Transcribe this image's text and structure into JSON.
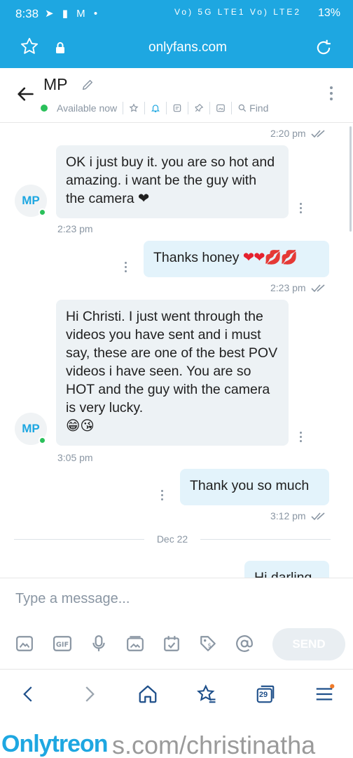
{
  "status_bar": {
    "time": "8:38",
    "battery": "13%",
    "network": "Vo) 5G LTE1 Vo) LTE2"
  },
  "browser": {
    "url": "onlyfans.com"
  },
  "chat_header": {
    "name": "MP",
    "presence": "Available now",
    "find_label": "Find"
  },
  "messages": [
    {
      "direction": "out",
      "text": "",
      "time": "2:20 pm"
    },
    {
      "direction": "in",
      "avatar": "MP",
      "text": "OK i just buy it. you are so hot and amazing. i want be the guy with the camera ❤",
      "time": "2:23 pm"
    },
    {
      "direction": "out",
      "text": "Thanks honey",
      "emoji": "❤❤💋💋",
      "time": "2:23 pm"
    },
    {
      "direction": "in",
      "avatar": "MP",
      "text": "Hi Christi. I just went through the videos you have sent and i must say, these are one of the best POV videos i have seen. You are so HOT and the guy with the camera is very lucky.",
      "emoji": "😁😘",
      "time": "3:05 pm"
    },
    {
      "direction": "out",
      "text": "Thank you so much",
      "time": "3:12 pm"
    },
    {
      "direction": "out",
      "text": "Hi darling",
      "time": ""
    }
  ],
  "date_divider": "Dec 22",
  "composer": {
    "placeholder": "Type a message...",
    "send_label": "SEND"
  },
  "browser_nav": {
    "tabs_count": "29"
  },
  "watermark": {
    "brand_a": "Only",
    "brand_b": "treon",
    "path": "s.com/christinatha"
  },
  "colors": {
    "brand": "#1ea7e1",
    "online": "#2ac05a",
    "incoming_bubble": "#edf2f5",
    "outgoing_bubble": "#e3f3fb"
  }
}
